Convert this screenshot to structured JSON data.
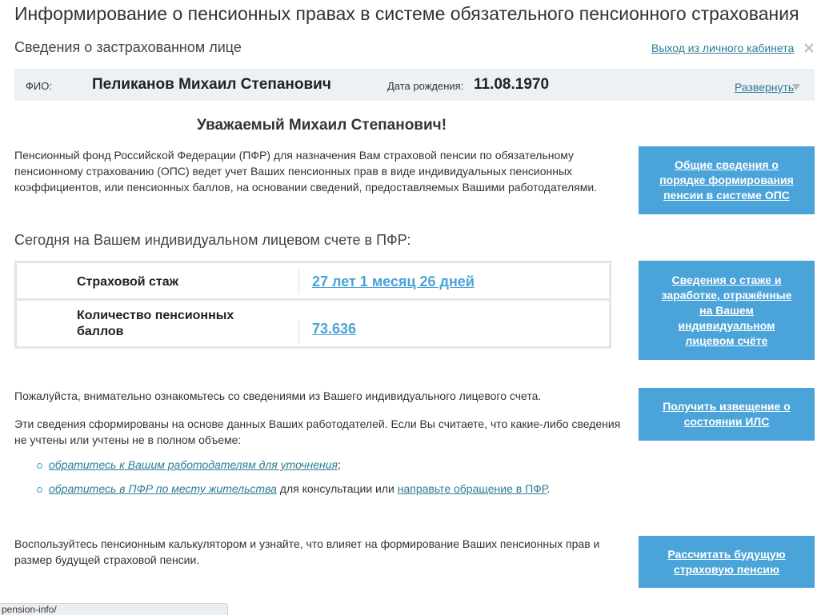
{
  "header": {
    "title": "Информирование о пенсионных правах в системе обязательного пенсионного страхования",
    "subtitle": "Сведения о застрахованном лице",
    "logout_label": "Выход из личного кабинета"
  },
  "person": {
    "fio_label": "ФИО:",
    "fio_value": "Пеликанов Михаил Степанович",
    "dob_label": "Дата рождения:",
    "dob_value": "11.08.1970",
    "expand_label": "Развернуть"
  },
  "main": {
    "greeting": "Уважаемый Михаил Степанович!",
    "intro": "Пенсионный фонд Российской Федерации (ПФР) для назначения Вам страховой пенсии по обязательному пенсионному страхованию (ОПС) ведет учет Ваших пенсионных прав в виде индивидуальных пенсионных коэффициентов, или пенсионных баллов, на основании сведений, предоставляемых Вашими работодателями.",
    "account_title": "Сегодня на Вашем индивидуальном лицевом счете в ПФР:",
    "stats": [
      {
        "label": "Страховой стаж",
        "value": "27 лет 1 месяц 26 дней"
      },
      {
        "label": "Количество пенсионных баллов",
        "value": "73.636"
      }
    ],
    "review_text": "Пожалуйста, внимательно ознакомьтесь со сведениями из Вашего индивидуального лицевого счета.",
    "employer_text": "Эти сведения сформированы на основе данных Ваших работодателей. Если Вы считаете, что какие-либо сведения не учтены или учтены не в полном объеме:",
    "bullet1": {
      "link": "обратитесь к Вашим работодателям для уточнения",
      "suffix": ";"
    },
    "bullet2": {
      "link1": "обратитесь в ПФР по месту жительства",
      "middle": " для консультации или ",
      "link2": "направьте обращение в ПФР",
      "suffix": "."
    },
    "calculator_text": "Воспользуйтесь пенсионным калькулятором и узнайте, что влияет на формирование Ваших пенсионных прав и размер будущей страховой пенсии."
  },
  "sidebar": {
    "buttons": [
      {
        "label": "Общие сведения о порядке формирования пенсии в системе ОПС"
      },
      {
        "label": "Сведения о стаже и заработке, отражённые на Вашем индивидуальном лицевом счёте"
      },
      {
        "label": "Получить извещение о состоянии ИЛС"
      },
      {
        "label": "Рассчитать будущую страховую пенсию"
      }
    ]
  },
  "statusbar": {
    "url": "pension-info/"
  },
  "colors": {
    "accent": "#4aa3d9",
    "link": "#2c7c94",
    "info_bar_bg": "#eef1f4"
  },
  "icons": {
    "close": "close-icon",
    "expand": "triangle-down-icon",
    "bullet": "circle-bullet-icon"
  }
}
